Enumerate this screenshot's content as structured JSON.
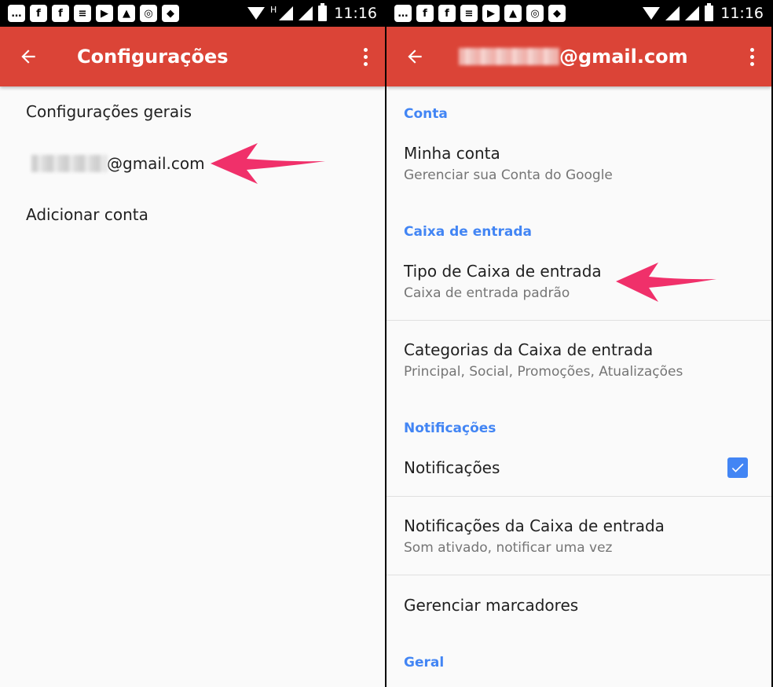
{
  "status_bar": {
    "time": "11:16",
    "network_label": "H",
    "icons": [
      "chat-icon",
      "facebook-icon",
      "facebook-icon",
      "news-icon",
      "youtube-icon",
      "image-icon",
      "instagram-icon",
      "maps-icon"
    ]
  },
  "left": {
    "title": "Configurações",
    "items": [
      {
        "label": "Configurações gerais"
      },
      {
        "label": "@gmail.com"
      },
      {
        "label": "Adicionar conta"
      }
    ]
  },
  "right": {
    "title": "@gmail.com",
    "sections": {
      "conta": "Conta",
      "caixa": "Caixa de entrada",
      "notificacoes": "Notificações",
      "geral": "Geral"
    },
    "prefs": {
      "minha_conta": {
        "title": "Minha conta",
        "subtitle": "Gerenciar sua Conta do Google"
      },
      "tipo_caixa": {
        "title": "Tipo de Caixa de entrada",
        "subtitle": "Caixa de entrada padrão"
      },
      "categorias": {
        "title": "Categorias da Caixa de entrada",
        "subtitle": "Principal, Social, Promoções, Atualizações"
      },
      "notificacoes": {
        "title": "Notificações",
        "checked": true
      },
      "notif_caixa": {
        "title": "Notificações da Caixa de entrada",
        "subtitle": "Som ativado, notificar uma vez"
      },
      "marcadores": {
        "title": "Gerenciar marcadores"
      }
    }
  },
  "colors": {
    "app_bar": "#db4437",
    "accent": "#4285f4",
    "arrow": "#f0306a"
  }
}
